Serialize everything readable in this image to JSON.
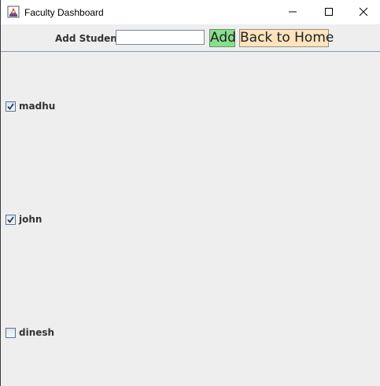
{
  "window": {
    "title": "Faculty Dashboard"
  },
  "toolbar": {
    "add_student_label": "Add Student:",
    "student_input_value": "",
    "add_button_label": "Add",
    "back_home_button_label": "Back to Home",
    "add_button_color": "#86e08a",
    "home_button_color": "#fde4bd"
  },
  "students": [
    {
      "name": "madhu",
      "checked": true
    },
    {
      "name": "john",
      "checked": true
    },
    {
      "name": "dinesh",
      "checked": false
    }
  ],
  "icons": {
    "app": "java-app-icon",
    "minimize": "minimize-icon",
    "maximize": "maximize-icon",
    "close": "close-icon",
    "check": "checkmark-icon"
  }
}
